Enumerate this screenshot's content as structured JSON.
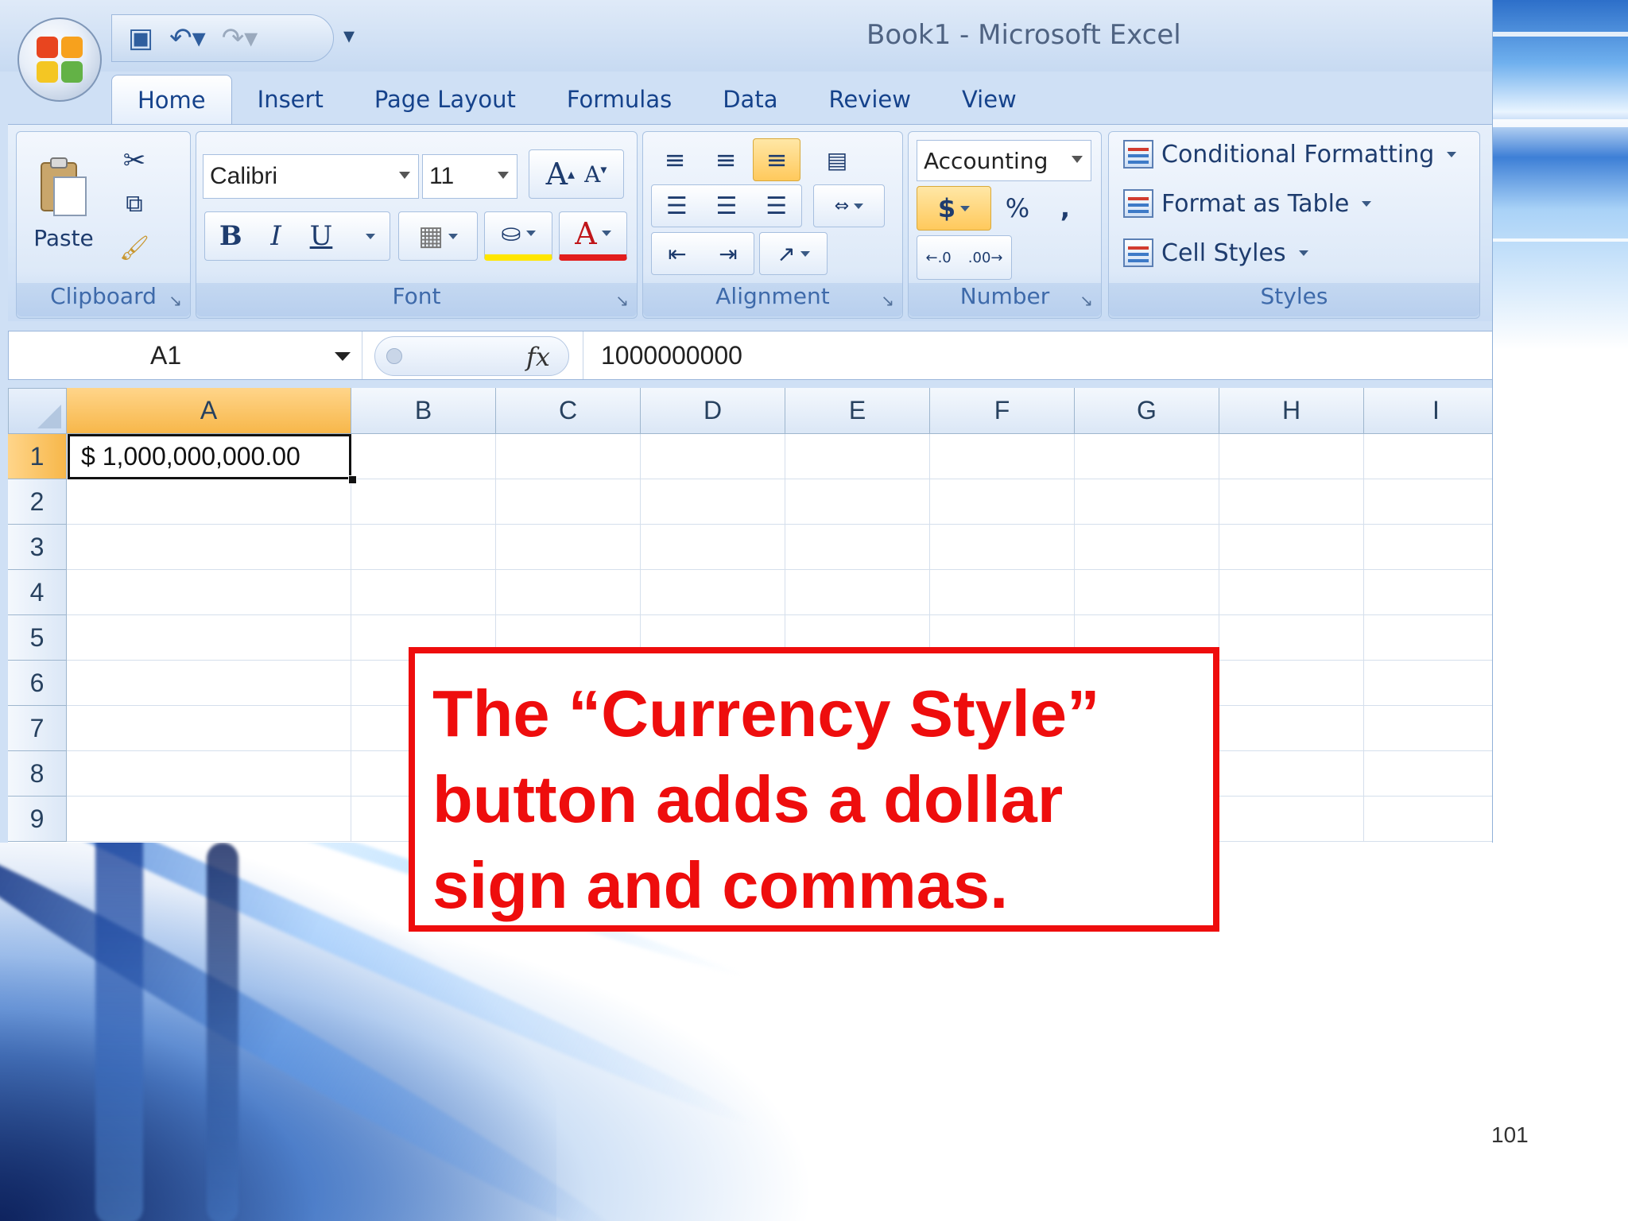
{
  "window": {
    "title": "Book1  -  Microsoft Excel"
  },
  "tabs": [
    {
      "label": "Home"
    },
    {
      "label": "Insert"
    },
    {
      "label": "Page Layout"
    },
    {
      "label": "Formulas"
    },
    {
      "label": "Data"
    },
    {
      "label": "Review"
    },
    {
      "label": "View"
    }
  ],
  "ribbon": {
    "clipboard": {
      "label": "Clipboard",
      "paste_label": "Paste"
    },
    "font": {
      "label": "Font",
      "font_name": "Calibri",
      "font_size": "11"
    },
    "alignment": {
      "label": "Alignment"
    },
    "number": {
      "label": "Number",
      "format": "Accounting",
      "currency_symbol": "$",
      "percent_symbol": "%",
      "comma_symbol": ","
    },
    "styles": {
      "label": "Styles",
      "conditional_formatting": "Conditional Formatting",
      "format_as_table": "Format as Table",
      "cell_styles": "Cell Styles"
    }
  },
  "formula_bar": {
    "name_box": "A1",
    "fx": "fx",
    "value": "1000000000"
  },
  "sheet": {
    "columns": [
      "A",
      "B",
      "C",
      "D",
      "E",
      "F",
      "G",
      "H",
      "I"
    ],
    "rows": [
      "1",
      "2",
      "3",
      "4",
      "5",
      "6",
      "7",
      "8",
      "9"
    ],
    "selected_cell": "A1",
    "a1_display": "$ 1,000,000,000.00"
  },
  "callout": {
    "text": "The “Currency Style”\nbutton adds a dollar\nsign and commas."
  },
  "slide": {
    "page_number": "101"
  },
  "colors": {
    "callout_red": "#ee0d0d",
    "selection_orange": "#f7b74a",
    "ribbon_blue": "#d6e5f7"
  }
}
